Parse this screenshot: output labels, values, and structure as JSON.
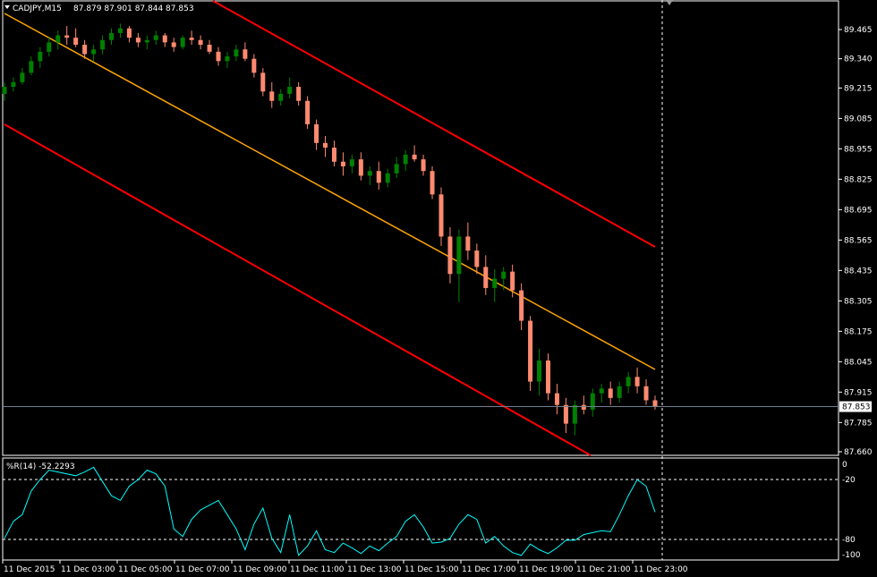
{
  "header": {
    "title": "CADJPY,M15",
    "ohlc": "87.879 87.901 87.844 87.853"
  },
  "indicator": {
    "label": "%R(14) -52.2293",
    "levels": [
      "0",
      "-20",
      "-80",
      "-100"
    ]
  },
  "colors": {
    "background": "#000000",
    "bull": "#008000",
    "bear": "#ff8a70",
    "channel": "#ff0000",
    "midline": "#ffa500",
    "wpr": "#00ffff",
    "grid": "#ffffff",
    "bidline": "#708090"
  },
  "chart_data": [
    {
      "type": "candlestick",
      "symbol": "CADJPY",
      "timeframe": "M15",
      "current_price": "87.853",
      "y_ticks": [
        "89.465",
        "89.340",
        "89.215",
        "89.085",
        "88.955",
        "88.825",
        "88.695",
        "88.565",
        "88.435",
        "88.305",
        "88.175",
        "88.045",
        "87.915",
        "87.785",
        "87.660"
      ],
      "ylim": [
        87.66,
        89.56
      ],
      "x_ticks": [
        "11 Dec 2015",
        "11 Dec 03:00",
        "11 Dec 05:00",
        "11 Dec 07:00",
        "11 Dec 09:00",
        "11 Dec 11:00",
        "11 Dec 13:00",
        "11 Dec 15:00",
        "11 Dec 17:00",
        "11 Dec 19:00",
        "11 Dec 21:00",
        "11 Dec 23:00"
      ],
      "ohlc": [
        [
          89.19,
          89.24,
          89.16,
          89.22
        ],
        [
          89.22,
          89.26,
          89.2,
          89.24
        ],
        [
          89.24,
          89.3,
          89.23,
          89.28
        ],
        [
          89.28,
          89.35,
          89.27,
          89.33
        ],
        [
          89.33,
          89.39,
          89.3,
          89.37
        ],
        [
          89.37,
          89.43,
          89.35,
          89.41
        ],
        [
          89.41,
          89.46,
          89.38,
          89.44
        ],
        [
          89.44,
          89.48,
          89.4,
          89.43
        ],
        [
          89.43,
          89.47,
          89.39,
          89.4
        ],
        [
          89.4,
          89.42,
          89.34,
          89.36
        ],
        [
          89.36,
          89.4,
          89.33,
          89.38
        ],
        [
          89.38,
          89.44,
          89.36,
          89.42
        ],
        [
          89.42,
          89.47,
          89.4,
          89.45
        ],
        [
          89.45,
          89.49,
          89.43,
          89.47
        ],
        [
          89.47,
          89.48,
          89.41,
          89.43
        ],
        [
          89.43,
          89.45,
          89.39,
          89.41
        ],
        [
          89.41,
          89.44,
          89.38,
          89.42
        ],
        [
          89.42,
          89.46,
          89.4,
          89.44
        ],
        [
          89.44,
          89.45,
          89.39,
          89.41
        ],
        [
          89.41,
          89.43,
          89.37,
          89.39
        ],
        [
          89.39,
          89.44,
          89.38,
          89.43
        ],
        [
          89.43,
          89.46,
          89.4,
          89.42
        ],
        [
          89.42,
          89.44,
          89.38,
          89.4
        ],
        [
          89.4,
          89.42,
          89.36,
          89.37
        ],
        [
          89.37,
          89.39,
          89.31,
          89.33
        ],
        [
          89.33,
          89.37,
          89.3,
          89.35
        ],
        [
          89.35,
          89.4,
          89.33,
          89.38
        ],
        [
          89.38,
          89.41,
          89.33,
          89.34
        ],
        [
          89.34,
          89.36,
          89.26,
          89.28
        ],
        [
          89.28,
          89.3,
          89.18,
          89.2
        ],
        [
          89.2,
          89.24,
          89.13,
          89.16
        ],
        [
          89.16,
          89.21,
          89.14,
          89.19
        ],
        [
          89.19,
          89.26,
          89.17,
          89.22
        ],
        [
          89.22,
          89.24,
          89.14,
          89.16
        ],
        [
          89.16,
          89.18,
          89.04,
          89.06
        ],
        [
          89.06,
          89.08,
          88.95,
          88.98
        ],
        [
          88.98,
          89.01,
          88.92,
          88.96
        ],
        [
          88.96,
          88.99,
          88.88,
          88.9
        ],
        [
          88.9,
          88.94,
          88.84,
          88.88
        ],
        [
          88.88,
          88.93,
          88.85,
          88.91
        ],
        [
          88.91,
          88.94,
          88.82,
          88.84
        ],
        [
          88.84,
          88.88,
          88.8,
          88.86
        ],
        [
          88.86,
          88.9,
          88.78,
          88.81
        ],
        [
          88.81,
          88.87,
          88.79,
          88.85
        ],
        [
          88.85,
          88.92,
          88.83,
          88.89
        ],
        [
          88.89,
          88.95,
          88.86,
          88.93
        ],
        [
          88.93,
          88.97,
          88.9,
          88.91
        ],
        [
          88.91,
          88.93,
          88.84,
          88.86
        ],
        [
          88.86,
          88.88,
          88.74,
          88.76
        ],
        [
          88.76,
          88.79,
          88.54,
          88.58
        ],
        [
          88.58,
          88.62,
          88.38,
          88.42
        ],
        [
          88.42,
          88.61,
          88.3,
          88.58
        ],
        [
          88.58,
          88.64,
          88.48,
          88.52
        ],
        [
          88.52,
          88.55,
          88.42,
          88.45
        ],
        [
          88.45,
          88.5,
          88.33,
          88.36
        ],
        [
          88.36,
          88.44,
          88.3,
          88.4
        ],
        [
          88.4,
          88.45,
          88.35,
          88.43
        ],
        [
          88.43,
          88.46,
          88.32,
          88.35
        ],
        [
          88.35,
          88.38,
          88.18,
          88.22
        ],
        [
          88.22,
          88.24,
          87.92,
          87.96
        ],
        [
          87.96,
          88.1,
          87.9,
          88.05
        ],
        [
          88.05,
          88.08,
          87.88,
          87.91
        ],
        [
          87.91,
          87.95,
          87.82,
          87.86
        ],
        [
          87.86,
          87.89,
          87.74,
          87.78
        ],
        [
          87.78,
          87.88,
          87.73,
          87.86
        ],
        [
          87.86,
          87.9,
          87.82,
          87.84
        ],
        [
          87.84,
          87.93,
          87.81,
          87.91
        ],
        [
          87.91,
          87.95,
          87.87,
          87.93
        ],
        [
          87.93,
          87.96,
          87.86,
          87.89
        ],
        [
          87.89,
          87.96,
          87.87,
          87.94
        ],
        [
          87.94,
          88.0,
          87.91,
          87.98
        ],
        [
          87.98,
          88.02,
          87.91,
          87.94
        ],
        [
          87.94,
          87.97,
          87.86,
          87.88
        ],
        [
          87.88,
          87.9,
          87.84,
          87.853
        ]
      ]
    },
    {
      "type": "line",
      "name": "%R(14)",
      "ylim": [
        -100,
        0
      ],
      "values": [
        -80,
        -62,
        -55,
        -30,
        -18,
        -8,
        -10,
        -12,
        -14,
        -10,
        -5,
        -20,
        -35,
        -40,
        -25,
        -18,
        -8,
        -12,
        -25,
        -70,
        -78,
        -60,
        -50,
        -45,
        -40,
        -55,
        -70,
        -92,
        -65,
        -48,
        -80,
        -95,
        -55,
        -98,
        -88,
        -72,
        -92,
        -95,
        -85,
        -90,
        -96,
        -88,
        -93,
        -85,
        -78,
        -62,
        -55,
        -68,
        -85,
        -84,
        -80,
        -65,
        -55,
        -60,
        -85,
        -78,
        -88,
        -95,
        -98,
        -86,
        -92,
        -96,
        -90,
        -82,
        -82,
        -76,
        -74,
        -72,
        -73,
        -55,
        -35,
        -18,
        -25,
        -52.2293
      ]
    }
  ]
}
